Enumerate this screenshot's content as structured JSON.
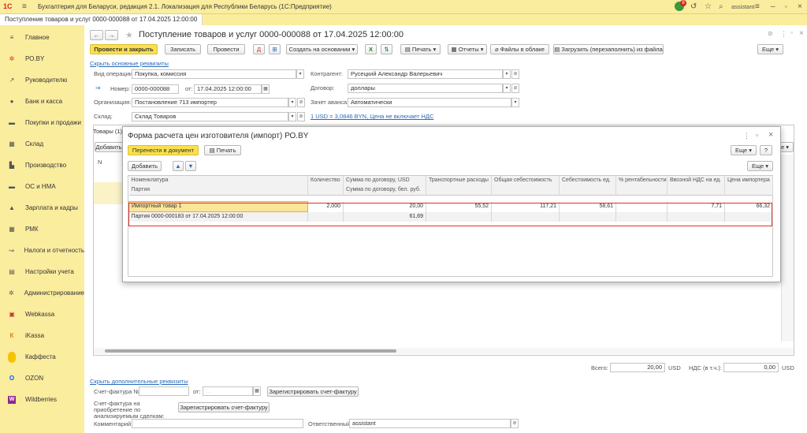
{
  "titlebar": {
    "logo": "1С",
    "app_title": "Бухгалтерия для Беларуси, редакция 2.1. Локализация для Республики Беларусь (1С:Предприятие)",
    "user": "assistant",
    "notification_count": "8"
  },
  "tab": {
    "label": "Поступление товаров и услуг 0000-000088 от 17.04.2025 12:00:00"
  },
  "sidebar": {
    "items": [
      {
        "label": "Главное",
        "icon": "menu-icon",
        "glyph": "≡"
      },
      {
        "label": "РО.BY",
        "icon": "star-icon",
        "glyph": "✲"
      },
      {
        "label": "Руководителю",
        "icon": "chart-icon",
        "glyph": "↗"
      },
      {
        "label": "Банк и касса",
        "icon": "coin-icon",
        "glyph": "●"
      },
      {
        "label": "Покупки и продажи",
        "icon": "cart-icon",
        "glyph": "▬"
      },
      {
        "label": "Склад",
        "icon": "warehouse-icon",
        "glyph": "▦"
      },
      {
        "label": "Производство",
        "icon": "factory-icon",
        "glyph": "▙"
      },
      {
        "label": "ОС и НМА",
        "icon": "assets-icon",
        "glyph": "▬"
      },
      {
        "label": "Зарплата и кадры",
        "icon": "people-icon",
        "glyph": "▲"
      },
      {
        "label": "РМК",
        "icon": "register-icon",
        "glyph": "▦"
      },
      {
        "label": "Налоги и отчетность",
        "icon": "taxes-icon",
        "glyph": "↝"
      },
      {
        "label": "Настройки учета",
        "icon": "settings-icon",
        "glyph": "▤"
      },
      {
        "label": "Администрирование",
        "icon": "gear-icon",
        "glyph": "✲"
      },
      {
        "label": "Webkassa",
        "icon": "webkassa-icon",
        "glyph": "▣"
      },
      {
        "label": "iKassa",
        "icon": "ikassa-icon",
        "glyph": "К"
      },
      {
        "label": "Каффеста",
        "icon": "kaffesta-icon",
        "glyph": ""
      },
      {
        "label": "OZON",
        "icon": "ozon-icon",
        "glyph": "O"
      },
      {
        "label": "Wildberries",
        "icon": "wildberries-icon",
        "glyph": "W"
      }
    ]
  },
  "doc": {
    "title": "Поступление товаров и услуг 0000-000088 от 17.04.2025 12:00:00",
    "toolbar": {
      "post_close": "Провести и закрыть",
      "save": "Записать",
      "post": "Провести",
      "create_based": "Создать на основании",
      "print": "Печать",
      "reports": "Отчеты",
      "cloud_files": "Файлы в облаке",
      "load_file": "Загрузить (перезаполнить) из файла",
      "more": "Еще"
    },
    "hide_details_link": "Скрыть основные реквизиты",
    "fields": {
      "operation_type_label": "Вид операции:",
      "operation_type": "Покупка, комиссия",
      "number_label": "Номер:",
      "number": "0000-000088",
      "date_label": "от:",
      "date": "17.04.2025 12:00:00",
      "organization_label": "Организация:",
      "organization": "Постановление 713 импортер",
      "warehouse_label": "Склад:",
      "warehouse": "Склад Товаров",
      "counterparty_label": "Контрагент:",
      "counterparty": "Русецкий Александр Валерьевич",
      "contract_label": "Договор:",
      "contract": "доллары",
      "advance_label": "Зачет аванса:",
      "advance": "Автоматически",
      "rate_link": "1 USD = 3,0846 BYN, Цена не включает НДС"
    },
    "goods_tab": "Товары (1)",
    "add_button": "Добавить",
    "grid_col_n": "N",
    "totals": {
      "total_label": "Всего:",
      "total_value": "20,00",
      "currency": "USD",
      "vat_label": "НДС (в т.ч.):",
      "vat_value": "0,00"
    },
    "show_extra_link": "Скрыть дополнительные реквизиты",
    "invoice_label": "Счет-фактура №:",
    "invoice_date_label": "от:",
    "invoice_date_placeholder": ". .",
    "register_invoice": "Зарегистрировать счет-фактуру",
    "invoice_analyzed_label": "Счет-фактура на приобретение по анализируемым сделкам:",
    "register_invoice2": "Зарегистрировать счет-фактуру",
    "comment_label": "Комментарий:",
    "responsible_label": "Ответственный:",
    "responsible": "assistant"
  },
  "modal": {
    "title": "Форма расчета цен изготовителя (импорт) РО.BY",
    "transfer_button": "Перенести в документ",
    "print_button": "Печать",
    "more": "Еще",
    "help": "?",
    "add_button": "Добавить",
    "inner_more": "Еще",
    "columns": [
      "Номенклатура",
      "Количество",
      "Сумма по договору, USD",
      "Транспортные расходы",
      "Общая себестоимость",
      "Себестоимость ед.",
      "% рентабельности",
      "Ввозной НДС на ед.",
      "Цена импортера"
    ],
    "subcolumns": [
      "Партия",
      "Сумма по договору, бел. руб."
    ],
    "row": {
      "item": "Импортный товар 1",
      "quantity": "2,000",
      "amount_usd": "20,00",
      "transport": "55,52",
      "total_cost": "117,21",
      "unit_cost": "58,61",
      "profitability": "",
      "vat_unit": "7,71",
      "importer_price": "66,32",
      "batch": "Партия 0000-000183 от 17.04.2025 12:00:00",
      "amount_byn": "61,69"
    }
  }
}
